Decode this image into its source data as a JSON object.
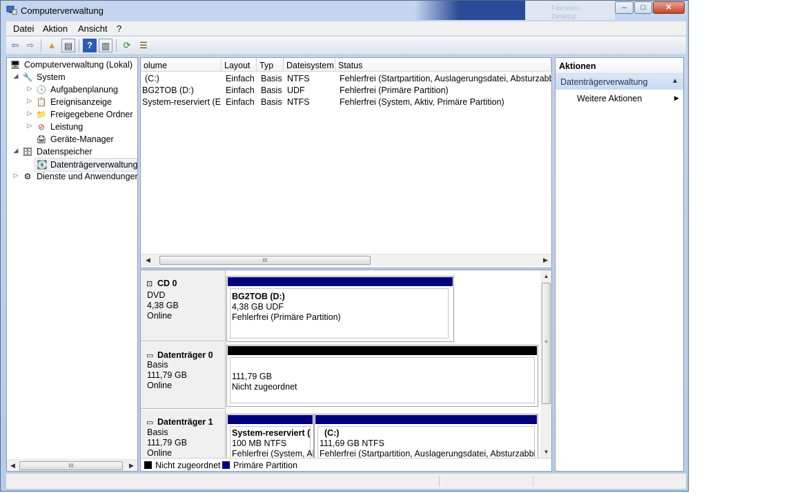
{
  "window": {
    "title": "Computerverwaltung",
    "behind_text": [
      "Favoriten",
      "Desktop"
    ],
    "controls": [
      "–",
      "□",
      "✕"
    ]
  },
  "menu": [
    "Datei",
    "Aktion",
    "Ansicht",
    "?"
  ],
  "toolbar_icons": [
    "back-arrow-icon",
    "forward-arrow-icon",
    "folder-up-icon",
    "show-hide-tree-icon",
    "help-icon",
    "show-hide-action-icon",
    "refresh-icon",
    "properties-icon"
  ],
  "toolbar_glyphs": [
    "⇦",
    "⇨",
    "▲",
    "▤",
    "?",
    "▥",
    "⟳",
    "☰"
  ],
  "tree": {
    "items": [
      {
        "label": "Computerverwaltung (Lokal)",
        "icon": "🖥",
        "twisty": ""
      },
      {
        "label": "System",
        "icon": "🔧",
        "twisty": "◢"
      },
      {
        "label": "Aufgabenplanung",
        "icon": "🕓",
        "twisty": "▷"
      },
      {
        "label": "Ereignisanzeige",
        "icon": "📋",
        "twisty": "▷"
      },
      {
        "label": "Freigegebene Ordner",
        "icon": "📁",
        "twisty": "▷"
      },
      {
        "label": "Leistung",
        "icon": "⊘",
        "twisty": "▷"
      },
      {
        "label": "Geräte-Manager",
        "icon": "🖨",
        "twisty": ""
      },
      {
        "label": "Datenspeicher",
        "icon": "🗄",
        "twisty": "◢"
      },
      {
        "label": "Datenträgerverwaltung",
        "icon": "💽",
        "twisty": ""
      },
      {
        "label": "Dienste und Anwendungen",
        "icon": "⚙",
        "twisty": "▷"
      }
    ]
  },
  "volumes": {
    "columns": [
      "olume",
      "Layout",
      "Typ",
      "Dateisystem",
      "Status"
    ],
    "rows": [
      [
        "(C:)",
        "Einfach",
        "Basis",
        "NTFS",
        "Fehlerfrei (Startpartition, Auslagerungsdatei, Absturzabbild"
      ],
      [
        "BG2TOB (D:)",
        "Einfach",
        "Basis",
        "UDF",
        "Fehlerfrei (Primäre Partition)"
      ],
      [
        "System-reserviert (E:)",
        "Einfach",
        "Basis",
        "NTFS",
        "Fehlerfrei (System, Aktiv, Primäre Partition)"
      ]
    ]
  },
  "disks": [
    {
      "name": "CD 0",
      "lines": [
        "DVD",
        "4,38 GB",
        "Online"
      ],
      "partitions": [
        {
          "color": "#00007f",
          "lines": [
            "BG2TOB  (D:)",
            "4,38 GB UDF",
            "Fehlerfrei (Primäre Partition)"
          ]
        }
      ]
    },
    {
      "name": "Datenträger 0",
      "lines": [
        "Basis",
        "111,79 GB",
        "Online"
      ],
      "partitions": [
        {
          "color": "#000000",
          "lines": [
            "",
            "111,79 GB",
            "Nicht zugeordnet"
          ]
        }
      ]
    },
    {
      "name": "Datenträger 1",
      "lines": [
        "Basis",
        "111,79 GB",
        "Online"
      ],
      "partitions": [
        {
          "color": "#00007f",
          "lines": [
            "System-reserviert  (",
            "100 MB NTFS",
            "Fehlerfrei (System, Al"
          ]
        },
        {
          "color": "#00007f",
          "lines": [
            "(C:)",
            "111,69 GB NTFS",
            "Fehlerfrei (Startpartition, Auslagerungsdatei, Absturzabbild"
          ]
        }
      ]
    }
  ],
  "legend": [
    {
      "label": "Nicht zugeordnet",
      "color": "#000000"
    },
    {
      "label": "Primäre Partition",
      "color": "#00007f"
    }
  ],
  "actions": {
    "header": "Aktionen",
    "section": "Datenträgerverwaltung",
    "section_arrow": "▲",
    "item": "Weitere Aktionen",
    "item_arrow": "▶"
  },
  "scroll_glyphs": {
    "left": "◀",
    "right": "▶",
    "up": "▲",
    "down": "▼",
    "grip": "III"
  }
}
